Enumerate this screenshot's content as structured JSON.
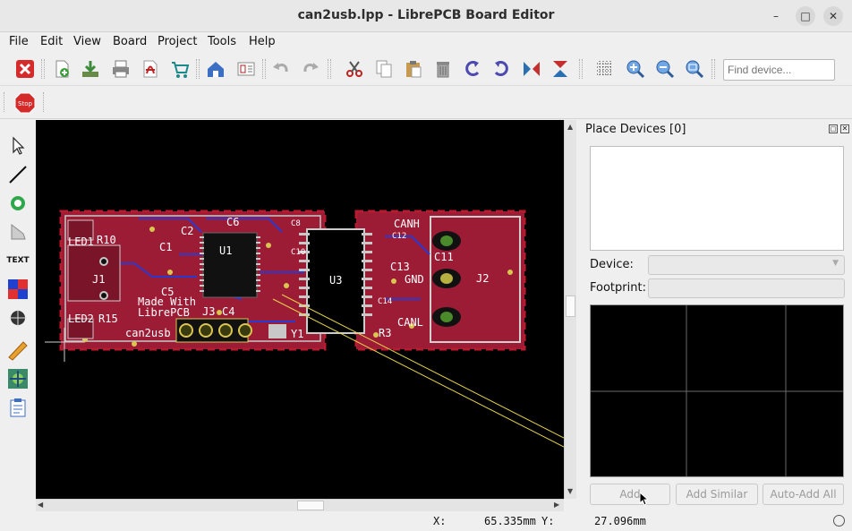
{
  "window": {
    "title": "can2usb.lpp - LibrePCB Board Editor"
  },
  "menu": [
    "File",
    "Edit",
    "View",
    "Board",
    "Project",
    "Tools",
    "Help"
  ],
  "toolbar": {
    "icons": [
      "close-project-icon",
      "new-sheet-icon",
      "save-icon",
      "print-icon",
      "export-pdf-icon",
      "order-pcb-icon",
      "control-panel-icon",
      "schematic-editor-icon",
      "undo-icon",
      "redo-icon",
      "cut-icon",
      "copy-icon",
      "paste-icon",
      "delete-icon",
      "rotate-ccw-icon",
      "rotate-cw-icon",
      "flip-horizontal-icon",
      "flip-vertical-icon",
      "grid-icon",
      "zoom-in-icon",
      "zoom-out-icon",
      "zoom-all-icon"
    ],
    "find_placeholder": "Find device..."
  },
  "toolbar2": {
    "stop_label": "Stop"
  },
  "left_tools": {
    "text_label": "TEXT"
  },
  "pcb": {
    "labels": {
      "led1": "LED1",
      "r10": "R10",
      "c2": "C2",
      "c1": "C1",
      "c6": "C6",
      "u1": "U1",
      "j1": "J1",
      "c5": "C5",
      "made_with": "Made With",
      "librepcb": "LibrePCB",
      "led2": "LED2",
      "r15": "R15",
      "can2usb": "can2usb",
      "j3": "J3",
      "c4": "C4",
      "y1": "Y1",
      "u3": "U3",
      "canh": "CANH",
      "c11": "C11",
      "c13": "C13",
      "gnd": "GND",
      "canl": "CANL",
      "r3": "R3",
      "j2": "J2",
      "c8": "C8",
      "c12": "C12",
      "c10": "C10",
      "c14": "C14"
    },
    "colors": {
      "board": "#9c1c36",
      "outline": "#c8c8c8",
      "copper": "#5a0a18",
      "silkscreen": "#ffffff",
      "ratsnest": "#e6d24a",
      "pad": "#d9c54f"
    }
  },
  "panel": {
    "title": "Place Devices [0]",
    "device_label": "Device:",
    "footprint_label": "Footprint:",
    "buttons": {
      "add": "Add",
      "add_similar": "Add Similar",
      "auto_add_all": "Auto-Add All"
    }
  },
  "status": {
    "x_label": "X:",
    "x_value": "65.335mm",
    "y_label": "Y:",
    "y_value": "27.096mm"
  }
}
